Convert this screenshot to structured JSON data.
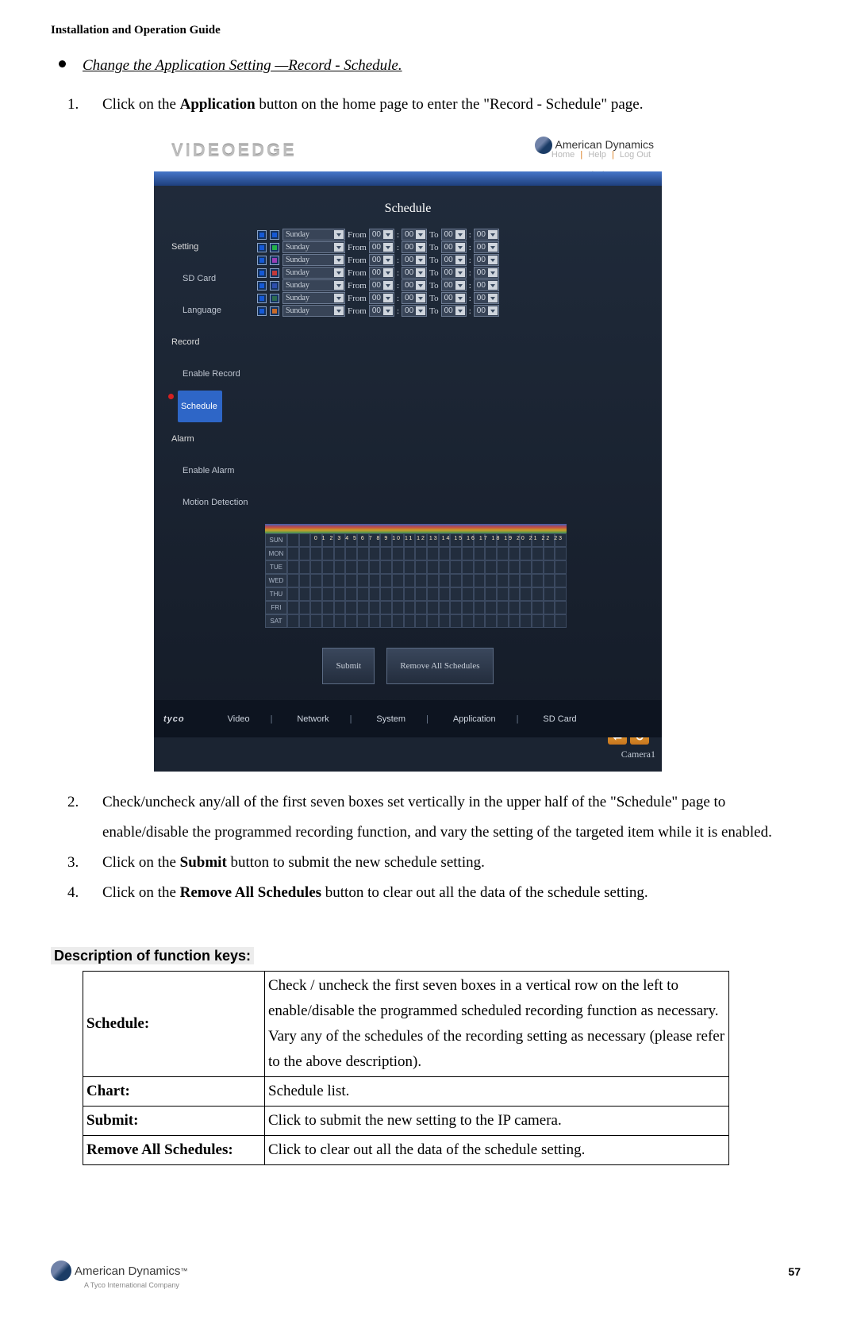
{
  "header": {
    "guide": "Installation and Operation Guide"
  },
  "bullet": {
    "text": "Change the Application Setting —Record - Schedule."
  },
  "step1": {
    "pre": "Click on the ",
    "bold": "Application",
    "post": " button on the home page to enter the \"Record - Schedule\" page."
  },
  "shot": {
    "brand": "VIDEOEDGE",
    "logo_text": "American Dynamics",
    "logo_sub": "A Tyco International Company",
    "topnav": {
      "home": "Home",
      "help": "Help",
      "logout": "Log Out"
    },
    "title": "Schedule",
    "sidebar": {
      "setting": "Setting",
      "items": [
        "SD Card",
        "Language"
      ],
      "record": "Record",
      "rec_items": [
        "Enable Record",
        "Schedule"
      ],
      "alarm": "Alarm",
      "alarm_items": [
        "Enable Alarm",
        "Motion Detection"
      ]
    },
    "rows": [
      {
        "color": "#1559d6",
        "day": "Sunday"
      },
      {
        "color": "#24b24a",
        "day": "Sunday"
      },
      {
        "color": "#9a3fb5",
        "day": "Sunday"
      },
      {
        "color": "#c23a3a",
        "day": "Sunday"
      },
      {
        "color": "#2d4fae",
        "day": "Sunday"
      },
      {
        "color": "#2c6b50",
        "day": "Sunday"
      },
      {
        "color": "#c76a2a",
        "day": "Sunday"
      }
    ],
    "row_labels": {
      "from": "From",
      "to": "To",
      "val": "00",
      "colon": ":"
    },
    "weekdays": [
      "SUN",
      "MON",
      "TUE",
      "WED",
      "THU",
      "FRI",
      "SAT"
    ],
    "hour_scale": "0 1 2 3 4 5 6 7 8 9 10 11 12 13 14 15 16 17 18 19 20 21 22 23",
    "buttons": {
      "submit": "Submit",
      "remove": "Remove All Schedules"
    },
    "arrows": {
      "left": "⬅",
      "right": "↻"
    },
    "bottom": {
      "brand": "tyco",
      "items": [
        "Video",
        "Network",
        "System",
        "Application",
        "SD Card"
      ]
    },
    "camera": "Camera1"
  },
  "step2": "Check/uncheck any/all of the first seven boxes set vertically in the upper half of the \"Schedule\" page to enable/disable the programmed recording function, and vary the setting of the targeted item while it is enabled.",
  "step3": {
    "pre": "Click on the ",
    "bold": "Submit",
    "post": " button to submit the new schedule setting."
  },
  "step4": {
    "pre": "Click on the ",
    "bold": "Remove All Schedules",
    "post": " button to clear out all the data of the schedule setting."
  },
  "fkeys_heading": "Description of function keys:",
  "ft": {
    "r1k": "Schedule:",
    "r1v": "Check / uncheck the first seven boxes in a vertical row on the left to enable/disable the programmed scheduled recording function as necessary. Vary any of the schedules of the recording setting as necessary (please refer to the above description).",
    "r2k": "Chart:",
    "r2v": "Schedule list.",
    "r3k": "Submit:",
    "r3v": "Click to submit the new setting to the IP camera.",
    "r4k": "Remove All Schedules:",
    "r4v": "Click to clear out all the data of the schedule setting."
  },
  "footer": {
    "brand": "American Dynamics",
    "sub": "A Tyco International Company",
    "page": "57"
  }
}
